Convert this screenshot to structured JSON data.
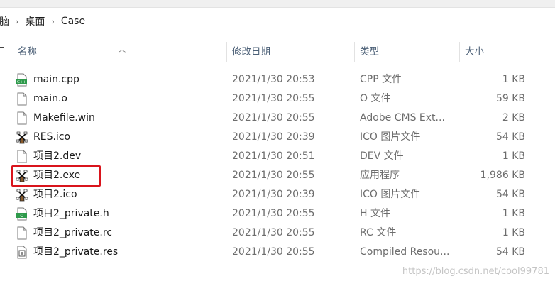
{
  "breadcrumb": {
    "items": [
      "脑",
      "桌面",
      "Case"
    ],
    "separator": "›"
  },
  "columns": {
    "name": "名称",
    "modified": "修改日期",
    "type": "类型",
    "size": "大小"
  },
  "files": [
    {
      "name": "main.cpp",
      "modified": "2021/1/30 20:53",
      "type": "CPP 文件",
      "size": "1 KB",
      "icon": "cpp-file-icon"
    },
    {
      "name": "main.o",
      "modified": "2021/1/30 20:55",
      "type": "O 文件",
      "size": "59 KB",
      "icon": "file-icon"
    },
    {
      "name": "Makefile.win",
      "modified": "2021/1/30 20:55",
      "type": "Adobe CMS Ext...",
      "size": "2 KB",
      "icon": "file-icon"
    },
    {
      "name": "RES.ico",
      "modified": "2021/1/30 20:39",
      "type": "ICO 图片文件",
      "size": "54 KB",
      "icon": "windmill-icon"
    },
    {
      "name": "项目2.dev",
      "modified": "2021/1/30 20:51",
      "type": "DEV 文件",
      "size": "1 KB",
      "icon": "file-icon"
    },
    {
      "name": "项目2.exe",
      "modified": "2021/1/30 20:55",
      "type": "应用程序",
      "size": "1,986 KB",
      "icon": "windmill-icon"
    },
    {
      "name": "项目2.ico",
      "modified": "2021/1/30 20:39",
      "type": "ICO 图片文件",
      "size": "54 KB",
      "icon": "windmill-icon"
    },
    {
      "name": "项目2_private.h",
      "modified": "2021/1/30 20:55",
      "type": "H 文件",
      "size": "1 KB",
      "icon": "h-file-icon"
    },
    {
      "name": "项目2_private.rc",
      "modified": "2021/1/30 20:55",
      "type": "RC 文件",
      "size": "1 KB",
      "icon": "file-icon"
    },
    {
      "name": "项目2_private.res",
      "modified": "2021/1/30 20:55",
      "type": "Compiled Resou...",
      "size": "54 KB",
      "icon": "res-file-icon"
    }
  ],
  "watermark": "https://blog.csdn.net/cool99781",
  "colors": {
    "highlight": "#d9141c",
    "header_text": "#4c6077",
    "muted_text": "#6d6d6d"
  }
}
